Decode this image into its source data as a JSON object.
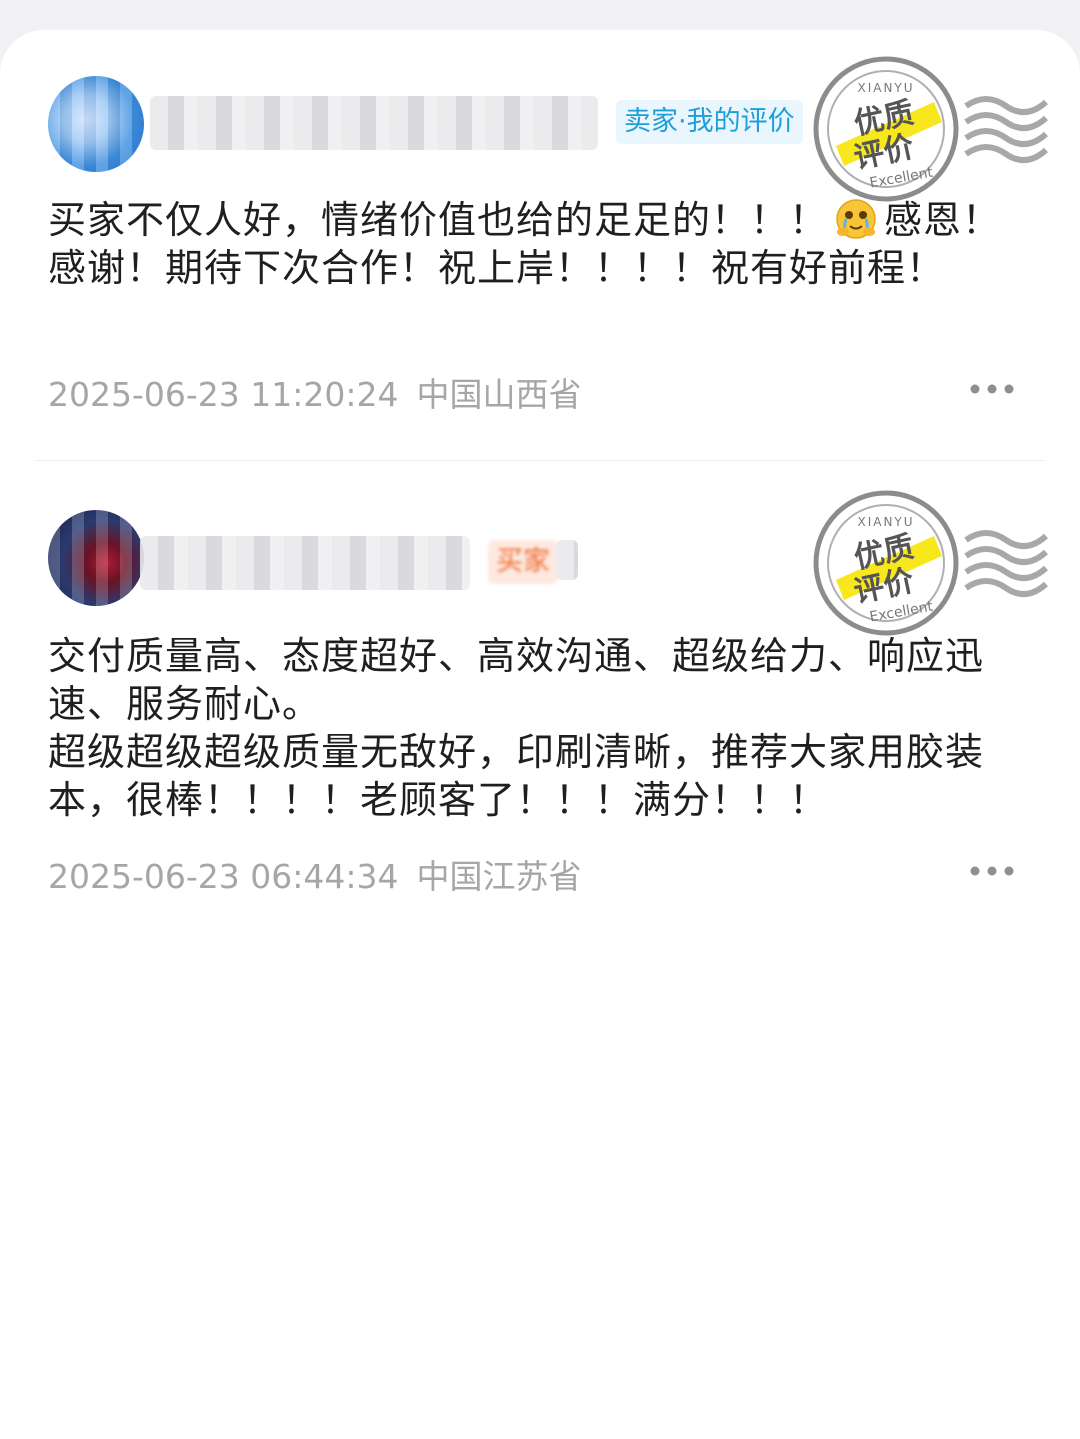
{
  "reviews": [
    {
      "role_label": "卖家·我的评价",
      "stamp": {
        "brand": "XIANYU",
        "line1": "优质",
        "line2": "评价",
        "sub": "Excellent"
      },
      "content_before_emoji": "买家不仅人好，情绪价值也给的足足的！！！",
      "emoji": "smiling-face-with-tears",
      "content_after_emoji": "感恩！感谢！期待下次合作！祝上岸！！！！祝有好前程！",
      "timestamp": "2025-06-23 11:20:24",
      "location": "中国山西省"
    },
    {
      "role_label": "买家",
      "stamp": {
        "brand": "XIANYU",
        "line1": "优质",
        "line2": "评价",
        "sub": "Excellent"
      },
      "content_before_emoji": "交付质量高、态度超好、高效沟通、超级给力、响应迅速、服务耐心。\n超级超级超级质量无敌好，印刷清晰，推荐大家用胶装本，很棒！！！！老顾客了！！！满分！！！",
      "emoji": "",
      "content_after_emoji": "",
      "timestamp": "2025-06-23 06:44:34",
      "location": "中国江苏省"
    }
  ],
  "colors": {
    "accent_teal": "#1e9fd8",
    "accent_orange": "#f26a2e",
    "stamp_yellow": "#f8e71c",
    "meta_gray": "#a6a6a8"
  }
}
